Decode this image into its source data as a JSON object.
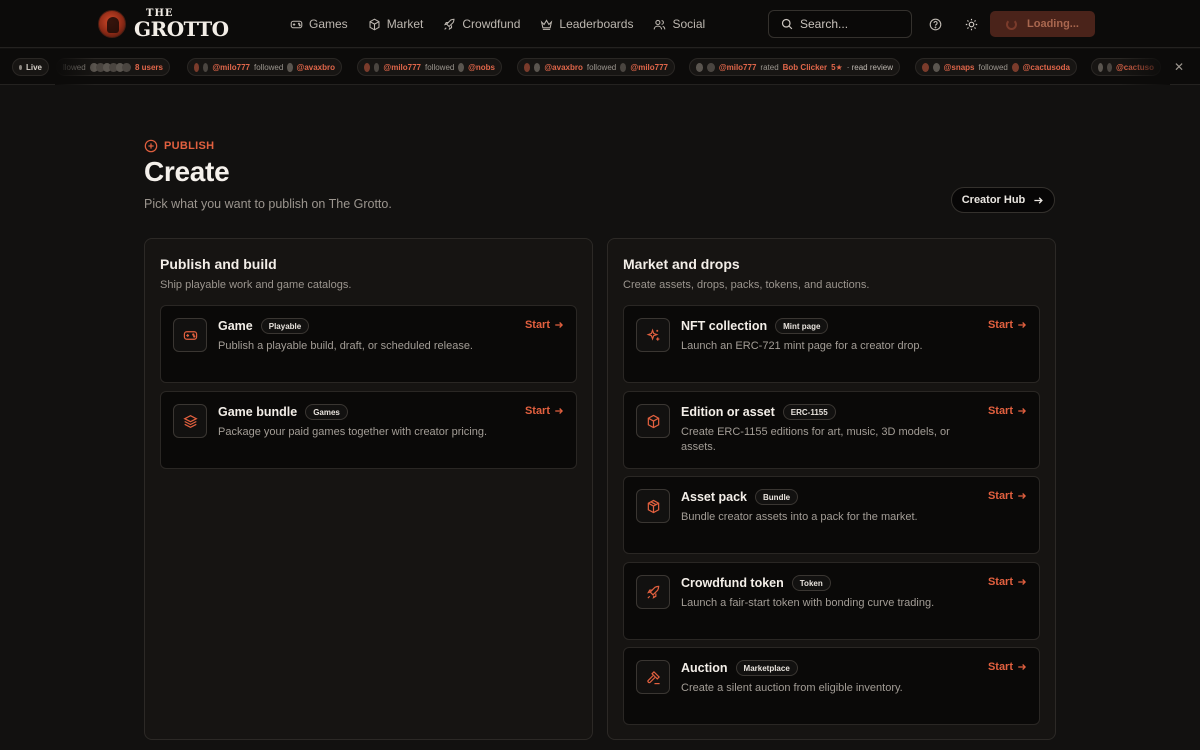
{
  "brand": {
    "the": "THE",
    "name": "GROTTO"
  },
  "nav": [
    {
      "id": "games",
      "label": "Games",
      "icon": "gamepad-icon"
    },
    {
      "id": "market",
      "label": "Market",
      "icon": "cube-icon"
    },
    {
      "id": "crowdfund",
      "label": "Crowdfund",
      "icon": "rocket-icon"
    },
    {
      "id": "leaderboards",
      "label": "Leaderboards",
      "icon": "crown-icon"
    },
    {
      "id": "social",
      "label": "Social",
      "icon": "users-icon"
    }
  ],
  "search": {
    "placeholder": "Search..."
  },
  "header": {
    "loading_label": "Loading..."
  },
  "ticker": {
    "live_label": "Live",
    "c1": {
      "prefix": "llowed",
      "tail": "8 users"
    },
    "c2": {
      "user": "@milo777",
      "verb": "followed",
      "target": "@avaxbro"
    },
    "c3": {
      "user": "@milo777",
      "verb": "followed",
      "target": "@nobs"
    },
    "c4": {
      "user": "@avaxbro",
      "verb": "followed",
      "target": "@milo777"
    },
    "c5": {
      "user": "@milo777",
      "verb": "rated",
      "game": "Bob Clicker",
      "rating": "5★",
      "link": "· read review"
    },
    "c6": {
      "user": "@snaps",
      "verb": "followed",
      "target": "@cactusoda"
    },
    "c7": {
      "user": "@cactuso"
    }
  },
  "hero": {
    "eyebrow": "PUBLISH",
    "title": "Create",
    "subtitle": "Pick what you want to publish on The Grotto.",
    "hub_label": "Creator Hub"
  },
  "panels": {
    "build": {
      "title": "Publish and build",
      "subtitle": "Ship playable work and game catalogs.",
      "cards": [
        {
          "title": "Game",
          "badge": "Playable",
          "desc": "Publish a playable build, draft, or scheduled release.",
          "action": "Start"
        },
        {
          "title": "Game bundle",
          "badge": "Games",
          "desc": "Package your paid games together with creator pricing.",
          "action": "Start"
        }
      ]
    },
    "market": {
      "title": "Market and drops",
      "subtitle": "Create assets, drops, packs, tokens, and auctions.",
      "cards": [
        {
          "title": "NFT collection",
          "badge": "Mint page",
          "desc": "Launch an ERC-721 mint page for a creator drop.",
          "action": "Start"
        },
        {
          "title": "Edition or asset",
          "badge": "ERC-1155",
          "desc": "Create ERC-1155 editions for art, music, 3D models, or assets.",
          "action": "Start"
        },
        {
          "title": "Asset pack",
          "badge": "Bundle",
          "desc": "Bundle creator assets into a pack for the market.",
          "action": "Start"
        },
        {
          "title": "Crowdfund token",
          "badge": "Token",
          "desc": "Launch a fair-start token with bonding curve trading.",
          "action": "Start"
        },
        {
          "title": "Auction",
          "badge": "Marketplace",
          "desc": "Create a silent auction from eligible inventory.",
          "action": "Start"
        }
      ]
    }
  },
  "colors": {
    "accent": "#e2603f",
    "background": "#121110",
    "panel": "#161412",
    "card": "#0a0908"
  }
}
